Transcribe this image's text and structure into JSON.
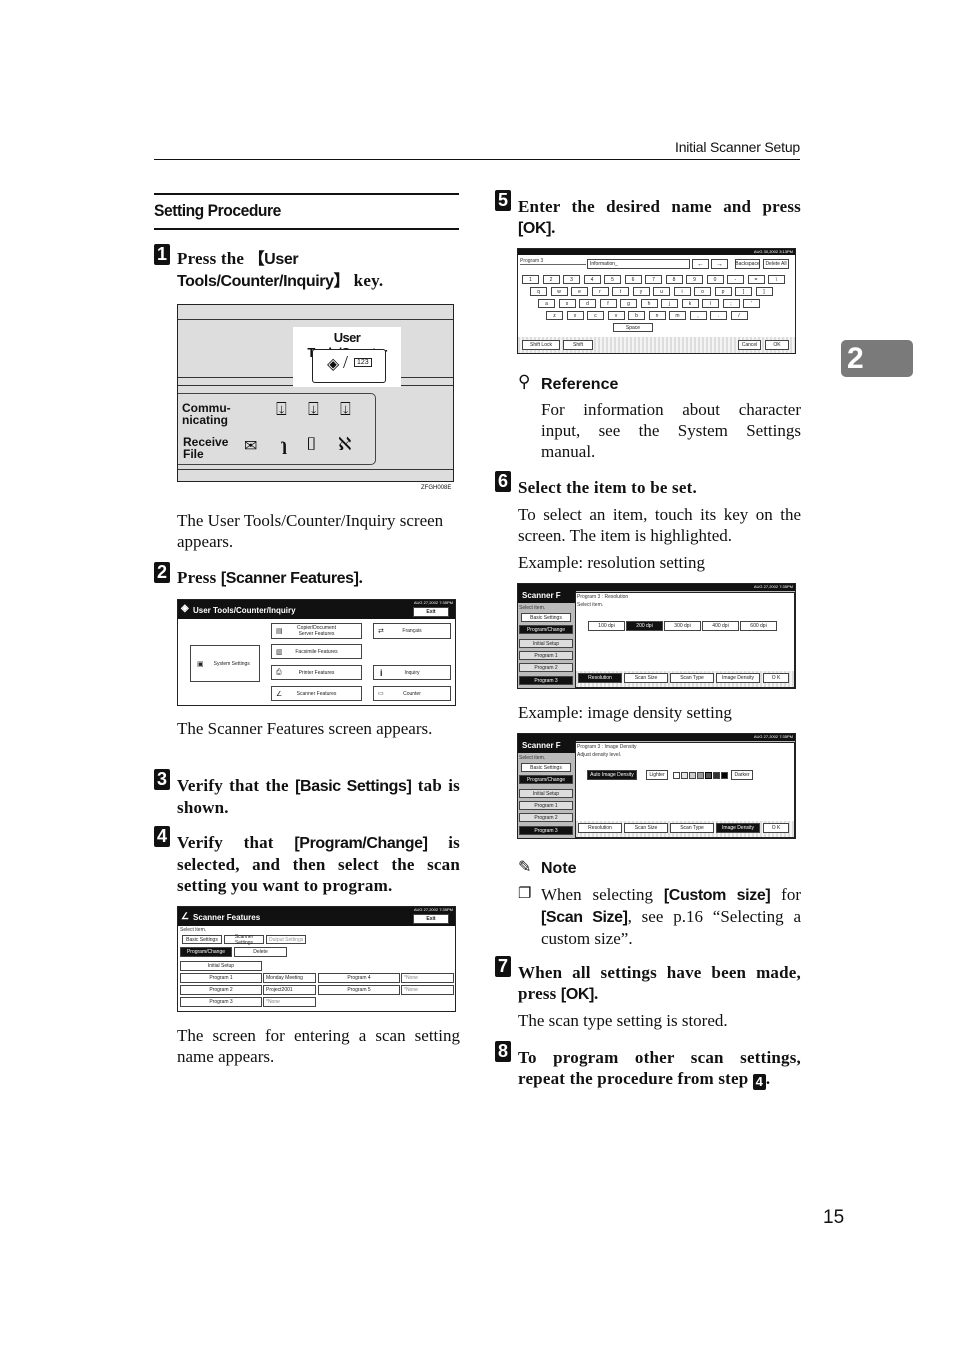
{
  "header": {
    "section": "Initial Scanner Setup"
  },
  "chapter_tab": "2",
  "page_number": "15",
  "section_title": "Setting Procedure",
  "steps": [
    {
      "num": "1",
      "pre": "Press the ",
      "key": "【User Tools/Counter/Inquiry】",
      "post": " key."
    },
    {
      "num": "2",
      "pre": "Press ",
      "key": "[Scanner Features]",
      "post": "."
    },
    {
      "num": "3",
      "pre": "Verify that the ",
      "key": "[Basic Settings]",
      "post": " tab is shown."
    },
    {
      "num": "4",
      "pre": "Verify that ",
      "key": "[Program/Change]",
      "post": " is selected, and then select the scan setting you want to program."
    },
    {
      "num": "5",
      "pre": "Enter the desired name and press ",
      "key": "[OK]",
      "post": "."
    },
    {
      "num": "6",
      "pre": "Select the item to be set.",
      "key": "",
      "post": ""
    },
    {
      "num": "7",
      "pre": "When all settings have been made, press ",
      "key": "[OK]",
      "post": "."
    },
    {
      "num": "8",
      "pre": "To program other scan settings, repeat the procedure from step ",
      "key": "",
      "post": "."
    }
  ],
  "step8_ref": "4",
  "texts": {
    "after1": "The User Tools/Counter/Inquiry screen appears.",
    "after2": "The Scanner Features screen appears.",
    "after4": "The screen for entering a scan setting name appears.",
    "step6_body": "To select an item, touch its key on the screen. The item is highlighted.",
    "example_resolution": "Example: resolution setting",
    "example_density": "Example: image density setting",
    "after7": "The scan type setting is stored."
  },
  "reference": {
    "title": "Reference",
    "body": "For information about character input, see the System Settings manual."
  },
  "note": {
    "title": "Note",
    "pre": "When selecting ",
    "key1": "[Custom size]",
    "mid": " for ",
    "key2": "[Scan Size]",
    "post": ", see p.16 “Selecting a custom size”."
  },
  "panel_fig": {
    "key_label": "User Tools/Counter",
    "key_counter": "123",
    "communicating": "Commu-\nnicating",
    "receive_file": "Receive\nFile",
    "fig_id": "ZFGH008E"
  },
  "screen_utc": {
    "title": "User Tools/Counter/Inquiry",
    "date": "AUG  27,2002  7:35PM",
    "exit": "Exit",
    "system_settings": "System Settings",
    "buttons": [
      "Copier/Document Server Features",
      "Facsimile Features",
      "Printer Features",
      "Scanner Features"
    ],
    "right_buttons": [
      "Français",
      "Inquiry",
      "Counter"
    ]
  },
  "screen_scanner": {
    "title": "Scanner Features",
    "date": "AUG  27,2002  7:35PM",
    "exit": "Exit",
    "select_item": "Select item.",
    "tabs": [
      "Basic Settings",
      "Scanner Settings",
      "Output Settings"
    ],
    "actions": [
      "Program/Change",
      "Delete"
    ],
    "initial_setup": "Initial Setup",
    "programs": [
      {
        "label": "Program 1",
        "value": "Monday  Meeting"
      },
      {
        "label": "Program 2",
        "value": "Project2001"
      },
      {
        "label": "Program 3",
        "value": "*None"
      },
      {
        "label": "Program 4",
        "value": "*None"
      },
      {
        "label": "Program 5",
        "value": "*None"
      }
    ]
  },
  "screen_keyboard": {
    "date": "AUG  30,2002  3:13PM",
    "label": "Program 3",
    "input_value": "Information_",
    "nav": [
      "←",
      "→"
    ],
    "backspace": "Backspace",
    "delete_all": "Delete All",
    "rows": [
      [
        "1",
        "2",
        "3",
        "4",
        "5",
        "6",
        "7",
        "8",
        "9",
        "0",
        "-",
        "=",
        "\\"
      ],
      [
        "q",
        "w",
        "e",
        "r",
        "t",
        "y",
        "u",
        "i",
        "o",
        "p",
        "[",
        "]"
      ],
      [
        "a",
        "s",
        "d",
        "f",
        "g",
        "h",
        "j",
        "k",
        "l",
        ";",
        "'"
      ],
      [
        "z",
        "x",
        "c",
        "v",
        "b",
        "n",
        "m",
        ",",
        ".",
        "/"
      ]
    ],
    "space": "Space",
    "shift_lock": "Shift Lock",
    "shift": "Shift",
    "cancel": "Cancel",
    "ok": "OK"
  },
  "screen_resolution": {
    "date": "AUG  27,2002  7:35PM",
    "bg_title": "Scanner F",
    "header": "Program 3 : Resolution",
    "instruction": "Select item.",
    "options": [
      "100 dpi",
      "200 dpi",
      "300 dpi",
      "400 dpi",
      "600 dpi"
    ],
    "selected_option": "200 dpi",
    "tabs": [
      "Resolution",
      "Scan Size",
      "Scan Type",
      "Image Density"
    ],
    "active_tab": "Resolution",
    "ok": "O K",
    "side": [
      "Select item.",
      "Basic Settings",
      "Program/Change",
      "Initial Setup",
      "Program 1",
      "Program 2",
      "Program 3"
    ]
  },
  "screen_density": {
    "date": "AUG  27,2002  7:35PM",
    "bg_title": "Scanner F",
    "header": "Program 3 : Image Density",
    "instruction": "Adjust density level.",
    "auto": "Auto Image Density",
    "lighter": "Lighter",
    "darker": "Darker",
    "level": 5,
    "levels": 7,
    "tabs": [
      "Resolution",
      "Scan Size",
      "Scan Type",
      "Image Density"
    ],
    "active_tab": "Image Density",
    "ok": "O K",
    "side": [
      "Select item.",
      "Basic Settings",
      "Program/Change",
      "Initial Setup",
      "Program 1",
      "Program 2",
      "Program 3"
    ]
  }
}
